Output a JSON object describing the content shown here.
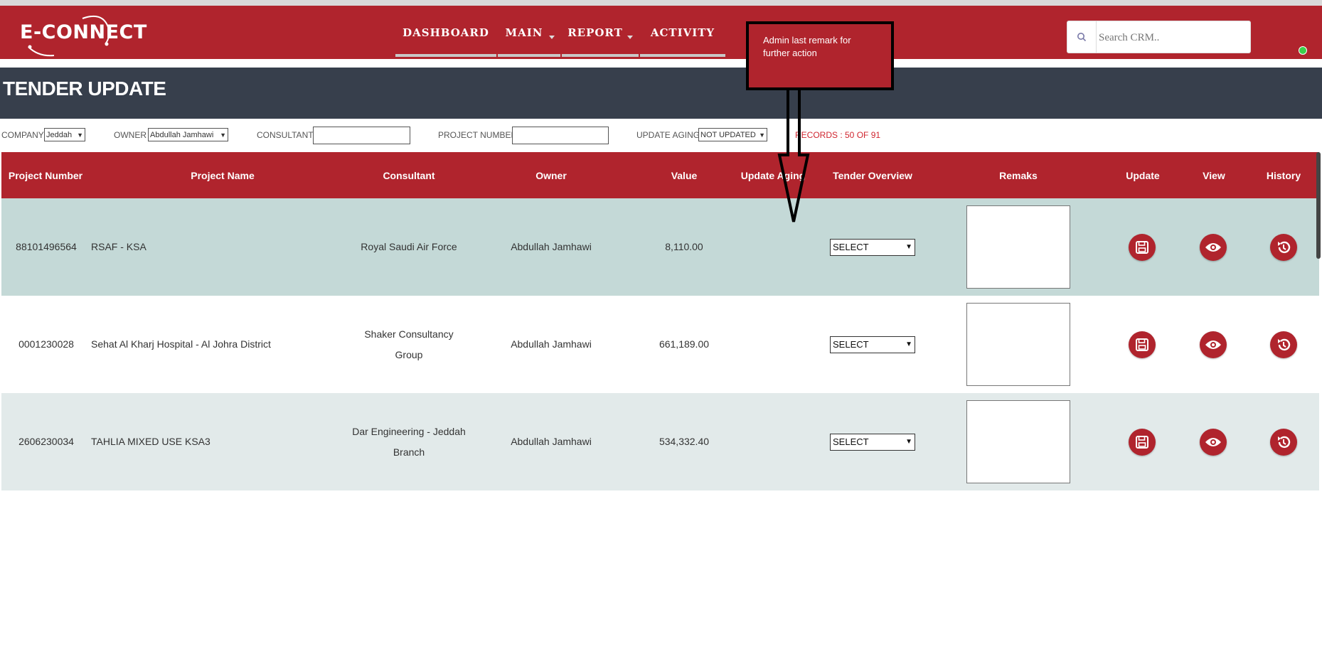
{
  "app": {
    "logo_text": "E-CONNECT"
  },
  "nav": {
    "items": [
      {
        "label": "DASHBOARD",
        "has_dropdown": false
      },
      {
        "label": "MAIN",
        "has_dropdown": true
      },
      {
        "label": "REPORT",
        "has_dropdown": true
      },
      {
        "label": "ACTIVITY",
        "has_dropdown": false
      }
    ],
    "search_placeholder": "Search CRM..",
    "search_icon": "search-icon",
    "status": "online"
  },
  "page": {
    "title": "TENDER UPDATE"
  },
  "filters": {
    "company_label": "COMPANY :",
    "company_value": "Jeddah",
    "owner_label": "OWNER :",
    "owner_value": "Abdullah Jamhawi",
    "consultant_label": "CONSULTANT :",
    "consultant_value": "",
    "project_number_label": "PROJECT NUMBER :",
    "project_number_value": "",
    "update_aging_label": "UPDATE AGING :",
    "update_aging_value": "NOT UPDATED",
    "records": "RECORDS : 50 OF 91"
  },
  "table": {
    "headers": [
      "Project Number",
      "Project Name",
      "Consultant",
      "Owner",
      "Value",
      "Update Aging",
      "Tender Overview",
      "Remaks",
      "Update",
      "View",
      "History"
    ],
    "rows": [
      {
        "project_number": "88101496564",
        "project_name": "RSAF - KSA",
        "consultant": "Royal Saudi Air Force",
        "owner": "Abdullah Jamhawi",
        "value": "8,110.00",
        "update_aging": "",
        "tender_overview": "SELECT",
        "remarks": ""
      },
      {
        "project_number": "0001230028",
        "project_name": "Sehat Al Kharj Hospital - Al Johra District",
        "consultant": "Shaker Consultancy Group",
        "owner": "Abdullah Jamhawi",
        "value": "661,189.00",
        "update_aging": "",
        "tender_overview": "SELECT",
        "remarks": ""
      },
      {
        "project_number": "2606230034",
        "project_name": "TAHLIA MIXED USE KSA3",
        "consultant": "Dar Engineering - Jeddah Branch",
        "owner": "Abdullah Jamhawi",
        "value": "534,332.40",
        "update_aging": "",
        "tender_overview": "SELECT",
        "remarks": ""
      }
    ]
  },
  "annotation": {
    "text": "Admin last remark for further action"
  },
  "colors": {
    "brand_red": "#b0242d",
    "title_bar": "#373f4c",
    "records_text": "#d0252f",
    "status_green": "#3bcf4a"
  }
}
